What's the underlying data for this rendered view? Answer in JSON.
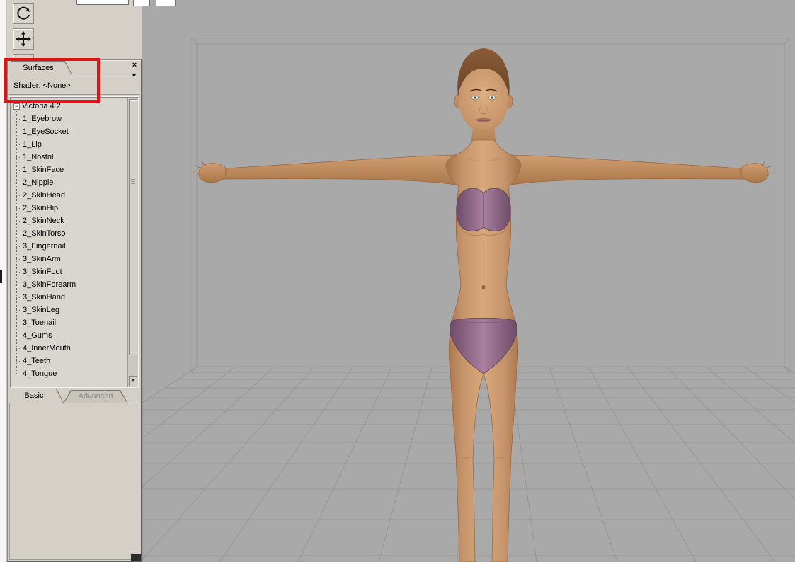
{
  "toolbar": {
    "icons": [
      {
        "name": "orbit-rotate-tool"
      },
      {
        "name": "pan-move-tool"
      },
      {
        "name": "zoom-dolly-tool"
      }
    ]
  },
  "surfaces_panel": {
    "tab_label": "Surfaces",
    "close_icon": "×",
    "menu_arrow_icon": "►",
    "shader_label": "Shader: <None>",
    "tree": {
      "root_label": "Victoria 4.2",
      "root_toggle": "−",
      "items": [
        "1_Eyebrow",
        "1_EyeSocket",
        "1_Lip",
        "1_Nostril",
        "1_SkinFace",
        "2_Nipple",
        "2_SkinHead",
        "2_SkinHip",
        "2_SkinNeck",
        "2_SkinTorso",
        "3_Fingernail",
        "3_SkinArm",
        "3_SkinFoot",
        "3_SkinForearm",
        "3_SkinHand",
        "3_SkinLeg",
        "3_Toenail",
        "4_Gums",
        "4_InnerMouth",
        "4_Teeth",
        "4_Tongue"
      ]
    },
    "scrollbar_down_icon": "▼",
    "bottom_tabs": {
      "basic": "Basic",
      "advanced": "Advanced"
    }
  },
  "viewport": {
    "colors": {
      "background": "#a9a9a9",
      "grid_lines": "#969696",
      "skin": "#c6946a",
      "underwear": "#9d6f96",
      "hair": "#7c4c2c"
    }
  },
  "annotation": {
    "type": "red-highlight-rectangle",
    "color": "#de1412"
  }
}
